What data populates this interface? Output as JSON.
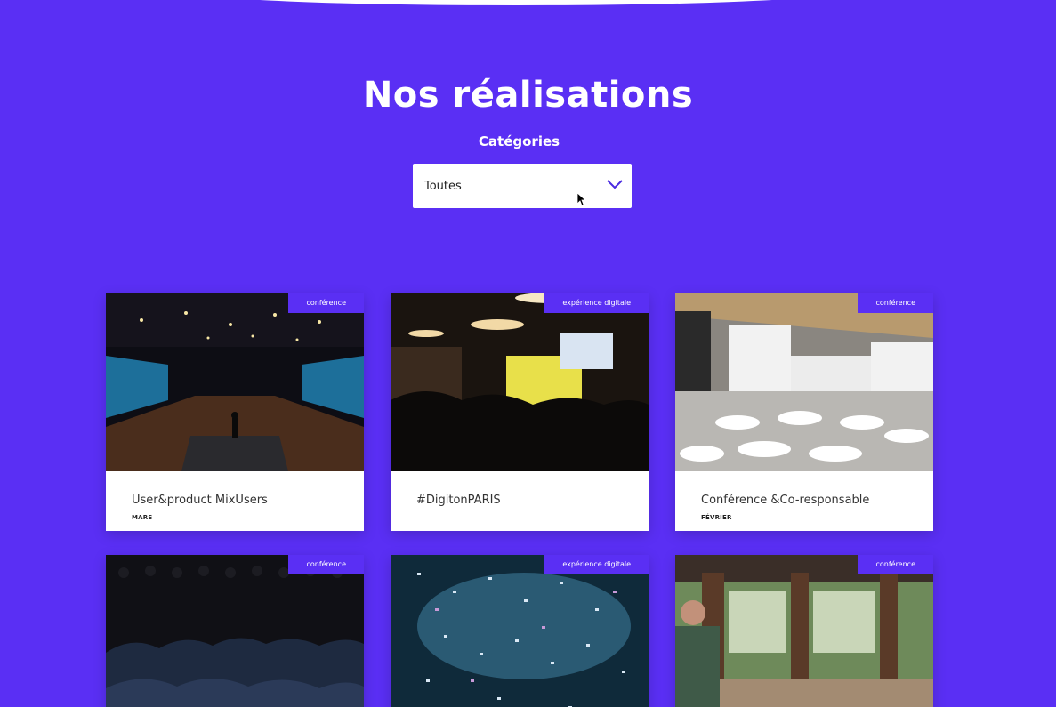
{
  "header": {
    "title": "Nos réalisations",
    "categories_label": "Catégories"
  },
  "filter": {
    "selected": "Toutes"
  },
  "cards": [
    {
      "tag": "conférence",
      "title": "User&product MixUsers",
      "month": "MARS"
    },
    {
      "tag": "expérience digitale",
      "title": "#DigitonPARIS",
      "month": ""
    },
    {
      "tag": "conférence",
      "title": "Conférence &Co-responsable",
      "month": "FÉVRIER"
    },
    {
      "tag": "conférence",
      "title": "",
      "month": ""
    },
    {
      "tag": "expérience digitale",
      "title": "",
      "month": ""
    },
    {
      "tag": "conférence",
      "title": "",
      "month": ""
    }
  ],
  "colors": {
    "background": "#5a2ff4",
    "tag": "#5a2ff4",
    "card": "#ffffff"
  }
}
